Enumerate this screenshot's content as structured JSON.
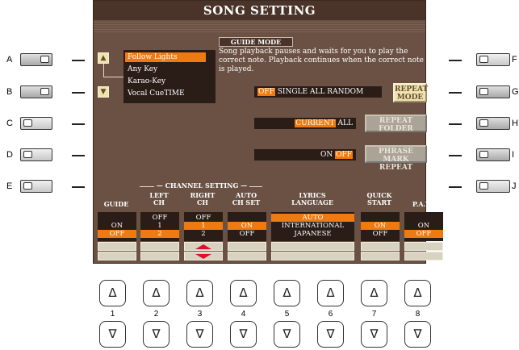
{
  "title": "SONG SETTING",
  "side_labels_left": [
    "A",
    "B",
    "C",
    "D",
    "E"
  ],
  "side_labels_right": [
    "F",
    "G",
    "H",
    "I",
    "J"
  ],
  "guide_mode": {
    "header": "GUIDE MODE",
    "description": "Song playback pauses and waits for you to play the correct note. Playback continues when the correct note is played.",
    "options": [
      "Follow Lights",
      "Any Key",
      "Karao-Key",
      "Vocal CueTIME"
    ],
    "selected": "Follow Lights"
  },
  "repeat": {
    "modes": [
      "OFF",
      "SINGLE",
      "ALL",
      "RANDOM"
    ],
    "selected": "OFF",
    "button": "REPEAT MODE"
  },
  "folder": {
    "modes": [
      "CURRENT",
      "ALL"
    ],
    "selected": "CURRENT",
    "button": "REPEAT FOLDER"
  },
  "phrase": {
    "modes": [
      "ON",
      "OFF"
    ],
    "selected": "OFF",
    "button": "PHRASE MARK REPEAT"
  },
  "channel_setting_label": "CHANNEL SETTING",
  "columns": {
    "guide": {
      "header": "GUIDE",
      "values": [
        "ON",
        "OFF"
      ],
      "selected": "OFF"
    },
    "left_ch": {
      "header": "LEFT CH",
      "values": [
        "OFF",
        "1",
        "2"
      ],
      "selected": "2"
    },
    "right_ch": {
      "header": "RIGHT CH",
      "values": [
        "OFF",
        "1",
        "2"
      ],
      "selected": "1"
    },
    "auto_ch": {
      "header": "AUTO CH SET",
      "values": [
        "ON",
        "OFF"
      ],
      "selected": "ON"
    },
    "lyrics": {
      "header": "LYRICS LANGUAGE",
      "values": [
        "AUTO",
        "INTERNATIONAL",
        "JAPANESE"
      ],
      "selected": "AUTO"
    },
    "quick": {
      "header": "QUICK START",
      "values": [
        "ON",
        "OFF"
      ],
      "selected": "ON"
    },
    "pat": {
      "header": "P.A.T.",
      "values": [
        "ON",
        "OFF"
      ],
      "selected": "OFF"
    }
  },
  "bottom_numbers": [
    "1",
    "2",
    "3",
    "4",
    "5",
    "6",
    "7",
    "8"
  ],
  "up_glyph": "Δ",
  "down_glyph": "∇",
  "colors": {
    "screen": "#6a5143",
    "highlight": "#f07a10",
    "button": "#ede4b0"
  }
}
